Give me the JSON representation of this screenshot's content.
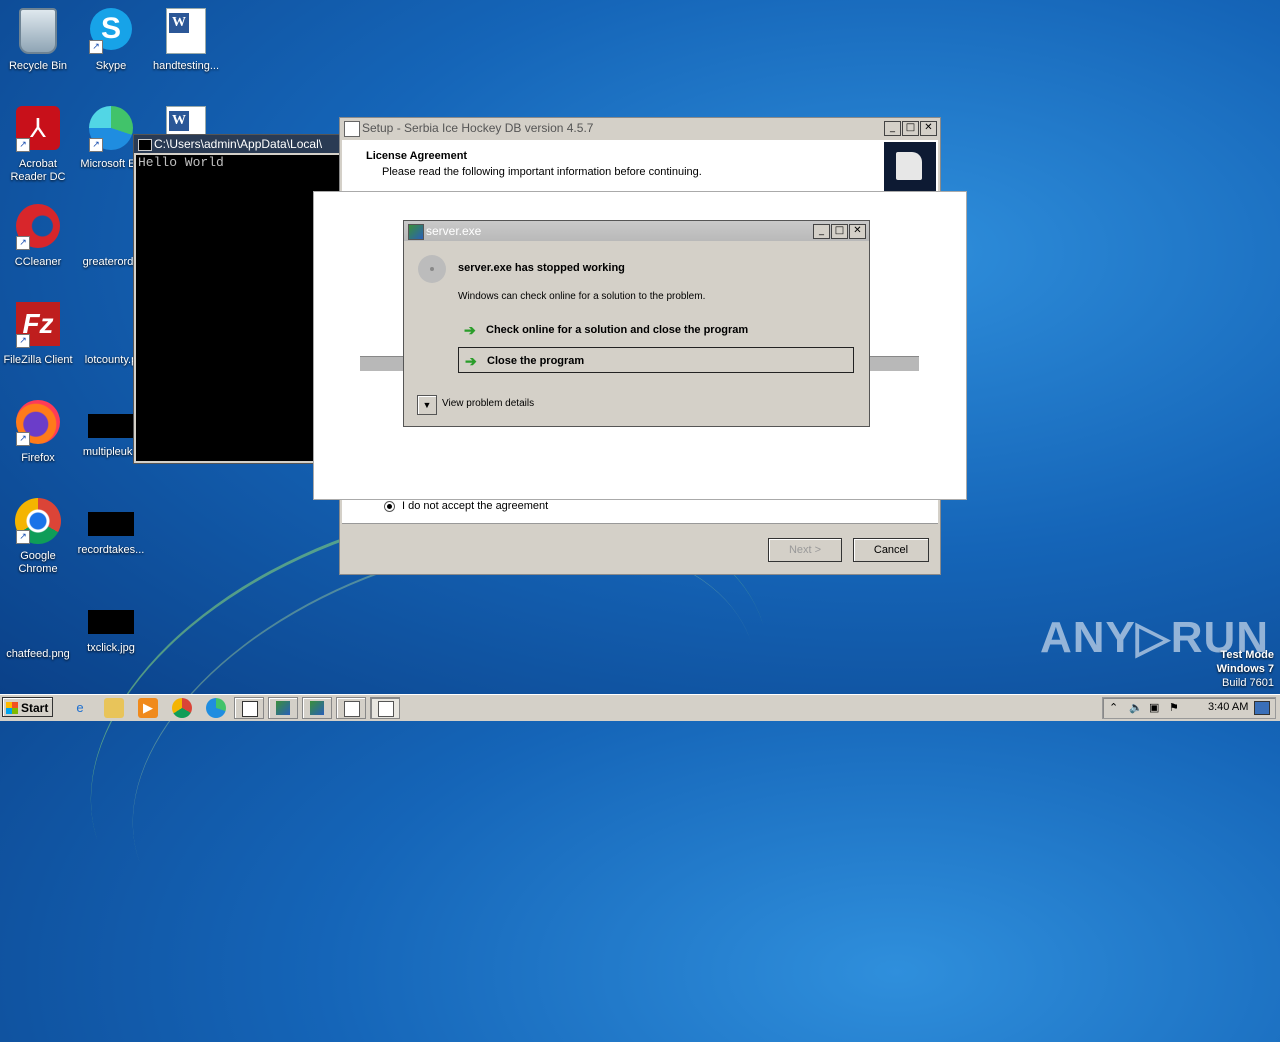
{
  "desktop": {
    "icons": [
      {
        "label": "Recycle Bin"
      },
      {
        "label": "Skype"
      },
      {
        "label": "handtesting..."
      },
      {
        "label": "Acrobat Reader DC"
      },
      {
        "label": "Microsoft Ed"
      },
      {
        "label": "CCleaner"
      },
      {
        "label": "greaterorde"
      },
      {
        "label": "FileZilla Client"
      },
      {
        "label": "lotcounty.p"
      },
      {
        "label": "Firefox"
      },
      {
        "label": "multipleuk.r"
      },
      {
        "label": "Google Chrome"
      },
      {
        "label": "recordtakes..."
      },
      {
        "label": "chatfeed.png"
      },
      {
        "label": "txclick.jpg"
      }
    ]
  },
  "console": {
    "title": "C:\\Users\\admin\\AppData\\Local\\",
    "output": "Hello World"
  },
  "setup": {
    "title": "Setup - Serbia Ice Hockey DB version 4.5.7",
    "heading": "License Agreement",
    "subheading": "Please read the following important information before continuing.",
    "radio_label": "I do not accept the agreement",
    "next_label": "Next >",
    "cancel_label": "Cancel"
  },
  "crash_dialog": {
    "title": "server.exe",
    "headline": "server.exe has stopped working",
    "message": "Windows can check online for a solution to the problem.",
    "option_check": "Check online for a solution and close the program",
    "option_close": "Close the program",
    "details_label": "View problem details"
  },
  "watermark": {
    "brand": "ANY▷RUN",
    "line1": "Test Mode",
    "line2": "Windows 7",
    "line3": "Build 7601"
  },
  "taskbar": {
    "start_label": "Start",
    "clock": "3:40 AM"
  }
}
